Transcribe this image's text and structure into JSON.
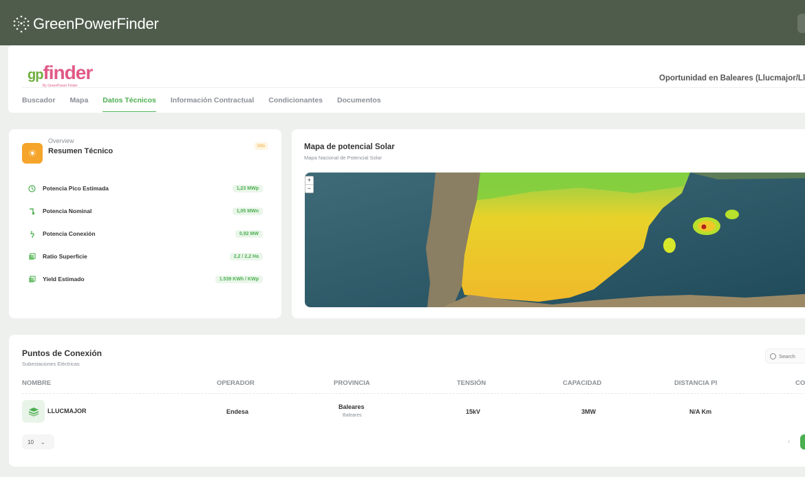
{
  "app": {
    "brand_name": "GreenPowerFinder",
    "sub_logo_gp": "gp",
    "sub_logo_finder": "finder",
    "sub_logo_by": "By GreenPower Finder"
  },
  "header": {
    "opportunity_title": "Oportunidad en Baleares (Llucmajor/Lluc"
  },
  "tabs": [
    {
      "label": "Buscador"
    },
    {
      "label": "Mapa"
    },
    {
      "label": "Datos Técnicos",
      "active": true
    },
    {
      "label": "Información Contractual"
    },
    {
      "label": "Condicionantes"
    },
    {
      "label": "Documentos"
    }
  ],
  "overview": {
    "kicker": "Overview",
    "title": "Resumen Técnico",
    "badge": "Info",
    "metrics": [
      {
        "label": "Potencia Pico Estimada",
        "value": "1,23 MWp",
        "icon": "solar-panel-icon"
      },
      {
        "label": "Potencia Nominal",
        "value": "1,05 MWn",
        "icon": "power-icon"
      },
      {
        "label": "Potencia Conexión",
        "value": "0,92 MW",
        "icon": "plug-icon"
      },
      {
        "label": "Ratio Superficie",
        "value": "2,2 / 2,2 Ha",
        "icon": "area-icon"
      },
      {
        "label": "Yield Estimado",
        "value": "1.539 KWh / KWp",
        "icon": "yield-icon"
      }
    ]
  },
  "map": {
    "title": "Mapa de potencial Solar",
    "subtitle": "Mapa Nacional de Potencial Solar",
    "zoom_in": "+",
    "zoom_out": "−"
  },
  "connection": {
    "title": "Puntos de Conexión",
    "subtitle": "Subestaciones Eléctricas",
    "search_placeholder": "Search",
    "columns": [
      "NOMBRE",
      "OPERADOR",
      "PROVINCIA",
      "TENSIÓN",
      "CAPACIDAD",
      "DISTANCIA PI",
      "CO"
    ],
    "rows": [
      {
        "nombre": "LLUCMAJOR",
        "operador": "Endesa",
        "provincia": "Baleares",
        "provincia_sub": "Baleares",
        "tension": "15kV",
        "capacidad": "3MW",
        "distancia": "N/A Km"
      }
    ],
    "page_size": "10",
    "prev_label": "‹"
  },
  "colors": {
    "topbar": "#4f5c4c",
    "accent": "#4caf50",
    "orange": "#f5a52b",
    "logo_pink": "#e05a86",
    "logo_green": "#6fae3d"
  }
}
